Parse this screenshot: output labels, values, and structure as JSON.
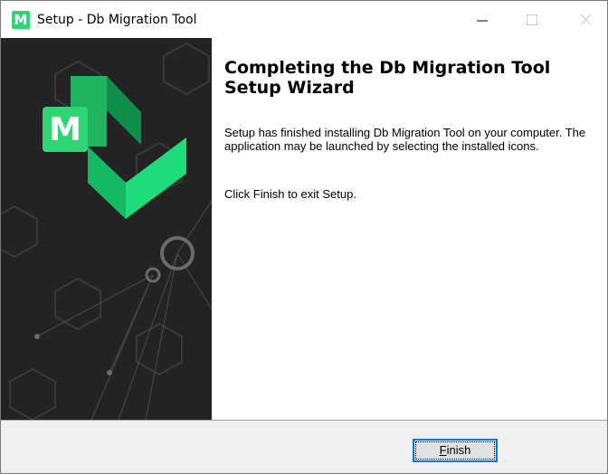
{
  "window": {
    "title": "Setup - Db Migration Tool",
    "app_icon_letter": "M",
    "controls": {
      "minimize": "minimize-icon",
      "maximize": "maximize-icon",
      "close": "close-icon"
    }
  },
  "banner": {
    "logo_letter": "M",
    "logo_colors": [
      "#2fd574",
      "#1fb560",
      "#0f8f4a"
    ]
  },
  "content": {
    "heading": "Completing the Db Migration Tool Setup Wizard",
    "paragraph1": "Setup has finished installing Db Migration Tool on your computer. The application may be launched by selecting the installed icons.",
    "paragraph2": "Click Finish to exit Setup."
  },
  "footer": {
    "finish_label_mnemonic": "F",
    "finish_label_rest": "inish"
  }
}
